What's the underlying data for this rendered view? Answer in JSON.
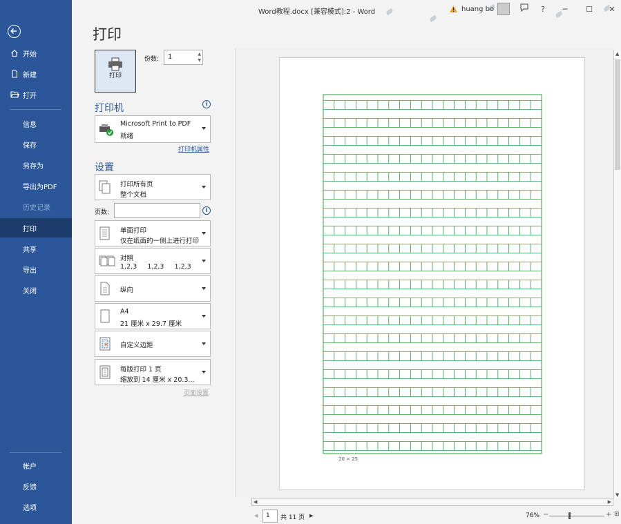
{
  "window": {
    "title": "Word教程.docx [兼容模式]:2  -  Word",
    "user": "huang bo",
    "min_label": "─",
    "max_label": "☐",
    "close_label": "✕",
    "help_label": "?"
  },
  "sidebar": {
    "items": [
      {
        "label": "开始",
        "icon": "home-icon"
      },
      {
        "label": "新建",
        "icon": "new-doc-icon"
      },
      {
        "label": "打开",
        "icon": "folder-open-icon"
      },
      {
        "label": "信息"
      },
      {
        "label": "保存"
      },
      {
        "label": "另存为"
      },
      {
        "label": "导出为PDF"
      },
      {
        "label": "历史记录"
      },
      {
        "label": "打印"
      },
      {
        "label": "共享"
      },
      {
        "label": "导出"
      },
      {
        "label": "关闭"
      }
    ],
    "bottom_items": [
      {
        "label": "帐户"
      },
      {
        "label": "反馈"
      },
      {
        "label": "选项"
      }
    ]
  },
  "print": {
    "page_title": "打印",
    "print_button": "打印",
    "copies_label": "份数:",
    "copies_value": "1",
    "printer_heading": "打印机",
    "printer_name": "Microsoft Print to PDF",
    "printer_status": "就绪",
    "printer_props_link": "打印机属性",
    "settings_heading": "设置",
    "pages_label": "页数:",
    "page_setup_link": "页面设置",
    "settings": [
      {
        "line1": "打印所有页",
        "line2": "整个文档"
      },
      {
        "line1": "单面打印",
        "line2": "仅在纸面的一侧上进行打印"
      },
      {
        "line1": "对照",
        "line2": "1,2,3     1,2,3     1,2,3"
      },
      {
        "line1": "纵向",
        "line2": ""
      },
      {
        "line1": "A4",
        "line2": "21 厘米 x 29.7 厘米"
      },
      {
        "line1": "自定义边距",
        "line2": ""
      },
      {
        "line1": "每版打印 1 页",
        "line2": "缩放到 14 厘米 x 20.3..."
      }
    ]
  },
  "preview": {
    "grid_caption": "20 × 25",
    "grid_cols": 20,
    "grid_rows": 20,
    "grid_color": "#2e9e3e",
    "current_page": "1",
    "total_pages": "共 11 页",
    "zoom": "76%"
  },
  "colors": {
    "sidebar": "#2b579a",
    "sidebar_active": "#1e3d6d",
    "accent": "#2b579a"
  }
}
